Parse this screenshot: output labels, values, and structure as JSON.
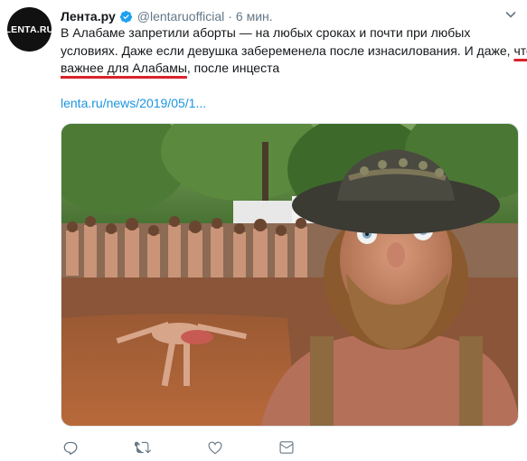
{
  "author": {
    "avatar_text": "LENTA.RU",
    "display_name": "Лента.ру",
    "handle": "@lentaruofficial",
    "separator": "·",
    "time": "6 мин."
  },
  "tweet": {
    "line1": "В Алабаме запретили аборты — на любых сроках и почти при любых",
    "line2_a": "условиях. Даже если девушка забеременела после изнасилования. И даже, ",
    "line2_underlined": "что",
    "line3_underlined": "важнее для Алабамы",
    "line3_b": ", после инцеста",
    "link": "lenta.ru/news/2019/05/1..."
  },
  "colors": {
    "link": "#1b95e0",
    "verified": "#1da1f2",
    "underline": "#d9232b",
    "muted": "#657786"
  },
  "actions": {
    "reply_icon": "reply-icon",
    "retweet_icon": "retweet-icon",
    "like_icon": "heart-icon",
    "dm_icon": "envelope-icon"
  }
}
